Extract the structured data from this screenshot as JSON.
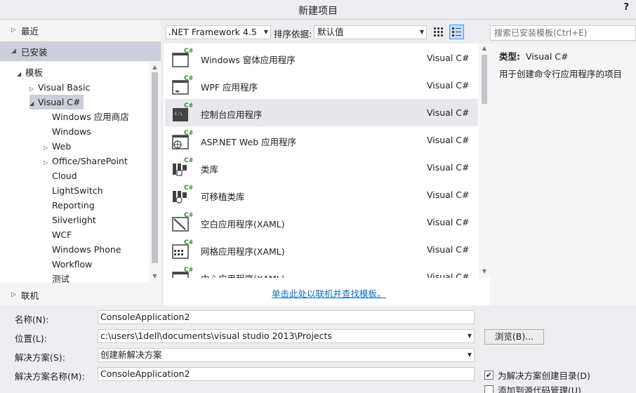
{
  "window": {
    "title": "新建项目",
    "help": "?"
  },
  "nav": {
    "recent": "最近",
    "installed": "已安装",
    "online": "联机",
    "tree": [
      {
        "label": "模板",
        "expander": "◢"
      },
      {
        "label": "Visual Basic",
        "expander": "▷"
      },
      {
        "label": "Visual C#",
        "expander": "◢"
      },
      {
        "label": "Windows 应用商店",
        "expander": ""
      },
      {
        "label": "Windows",
        "expander": ""
      },
      {
        "label": "Web",
        "expander": "▷"
      },
      {
        "label": "Office/SharePoint",
        "expander": "▷"
      },
      {
        "label": "Cloud",
        "expander": ""
      },
      {
        "label": "LightSwitch",
        "expander": ""
      },
      {
        "label": "Reporting",
        "expander": ""
      },
      {
        "label": "Silverlight",
        "expander": ""
      },
      {
        "label": "WCF",
        "expander": ""
      },
      {
        "label": "Windows Phone",
        "expander": ""
      },
      {
        "label": "Workflow",
        "expander": ""
      },
      {
        "label": "测试",
        "expander": ""
      }
    ]
  },
  "toolbar": {
    "framework": ".NET Framework 4.5",
    "sort_label": "排序依据:",
    "sort_value": "默认值",
    "search_placeholder": "搜索已安装模板(Ctrl+E)"
  },
  "templates": [
    {
      "name": "Windows 窗体应用程序",
      "lang": "Visual C#",
      "icon": "windows-forms-icon"
    },
    {
      "name": "WPF 应用程序",
      "lang": "Visual C#",
      "icon": "wpf-icon"
    },
    {
      "name": "控制台应用程序",
      "lang": "Visual C#",
      "icon": "console-icon",
      "selected": true
    },
    {
      "name": "ASP.NET Web 应用程序",
      "lang": "Visual C#",
      "icon": "aspnet-icon"
    },
    {
      "name": "类库",
      "lang": "Visual C#",
      "icon": "class-library-icon"
    },
    {
      "name": "可移植类库",
      "lang": "Visual C#",
      "icon": "portable-library-icon"
    },
    {
      "name": "空白应用程序(XAML)",
      "lang": "Visual C#",
      "icon": "blank-app-icon"
    },
    {
      "name": "网格应用程序(XAML)",
      "lang": "Visual C#",
      "icon": "grid-app-icon"
    },
    {
      "name": "中心应用程序(XAML)",
      "lang": "Visual C#",
      "icon": "hub-app-icon"
    }
  ],
  "online_link": "单击此处以联机并查找模板。",
  "description": {
    "type_label": "类型:",
    "type_value": "Visual C#",
    "text": "用于创建命令行应用程序的项目"
  },
  "form": {
    "name_label": "名称(N):",
    "name_value": "ConsoleApplication2",
    "location_label": "位置(L):",
    "location_value": "c:\\users\\1dell\\documents\\visual studio 2013\\Projects",
    "browse": "浏览(B)...",
    "solution_label": "解决方案(S):",
    "solution_value": "创建新解决方案",
    "solution_name_label": "解决方案名称(M):",
    "solution_name_value": "ConsoleApplication2",
    "create_dir_label": "为解决方案创建目录(D)",
    "create_dir_checked": true,
    "source_control_label": "添加到源代码管理(U)",
    "source_control_checked": false
  },
  "colors": {
    "accent": "#3399ff",
    "link": "#0e70c0",
    "csharp_green": "#388a34",
    "selected_bg": "#cccedb"
  }
}
